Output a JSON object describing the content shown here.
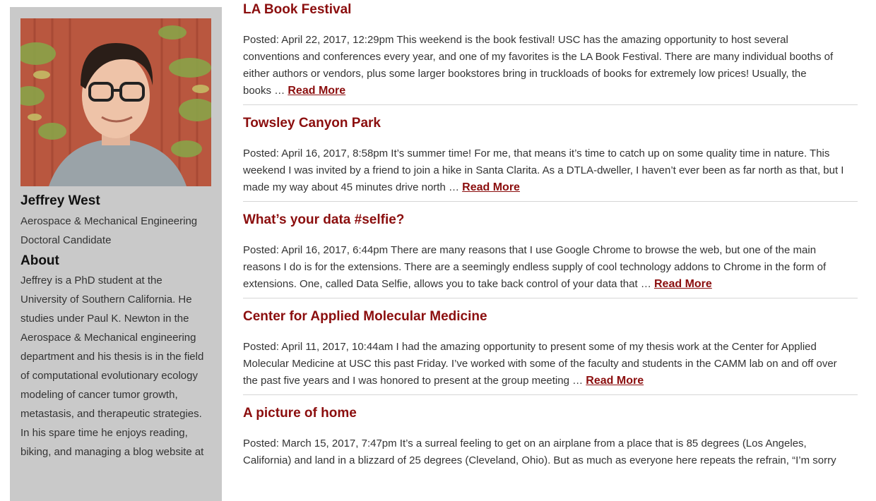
{
  "profile": {
    "name": "Jeffrey West",
    "role_line1": "Aerospace & Mechanical Engineering",
    "role_line2": "Doctoral Candidate",
    "about_heading": "About",
    "about_lines": [
      "Jeffrey is a PhD student at the",
      "University of Southern California. He",
      "studies under Paul K. Newton in the",
      "Aerospace & Mechanical engineering",
      "department and his thesis is in the field",
      "of computational evolutionary ecology",
      "modeling of cancer tumor growth,",
      "metastasis, and therapeutic strategies.",
      "In his spare time he enjoys reading,",
      "biking, and managing a blog website at"
    ]
  },
  "posts": [
    {
      "title": "LA Book Festival",
      "lines": [
        "Posted: April 22, 2017, 12:29pm This weekend is the book festival! USC has the amazing opportunity to host several",
        "conventions and conferences every year, and one of my favorites is the LA Book Festival. There are  many individual booths of",
        "either authors or vendors, plus some larger bookstores bring in truckloads of books for extremely low prices! Usually, the"
      ],
      "last_line": "books …",
      "read_more": "Read More"
    },
    {
      "title": "Towsley Canyon Park",
      "lines": [
        "Posted: April 16, 2017, 8:58pm It’s summer time! For me, that means it’s time to catch up on some quality time in nature. This",
        "weekend I was invited by a friend to join a hike in Santa Clarita. As a DTLA-dweller, I haven’t ever been as far north as that, but I"
      ],
      "last_line": "made my way about 45 minutes drive north …",
      "read_more": "Read More"
    },
    {
      "title": "What’s your data #selfie?",
      "lines": [
        "Posted: April 16, 2017, 6:44pm There are many reasons that I use Google Chrome to browse the web, but one of the main",
        "reasons I do is for the extensions. There are a seemingly endless supply of cool technology addons to Chrome in the form of"
      ],
      "last_line": "extensions. One, called Data Selfie, allows you to take back control of your data that …",
      "read_more": "Read More"
    },
    {
      "title": "Center for Applied Molecular Medicine",
      "lines": [
        "Posted: April 11, 2017, 10:44am I had the amazing opportunity to present some of my thesis work at the Center for Applied",
        "Molecular Medicine at USC this past Friday. I’ve worked with some of the faculty and students in the CAMM lab on and off over"
      ],
      "last_line": "the past five years and I was honored to present at the group meeting …",
      "read_more": "Read More"
    },
    {
      "title": "A picture of home",
      "lines": [
        "Posted: March 15, 2017, 7:47pm It’s a surreal feeling to get on an airplane from a place that is 85 degrees (Los Angeles,",
        "California) and land in a blizzard of 25 degrees (Cleveland, Ohio). But as much as everyone here repeats the refrain, “I’m sorry"
      ],
      "last_line": "",
      "read_more": ""
    }
  ],
  "colors": {
    "accent": "#8b0e0e",
    "sidebar_bg": "#c9c9c9",
    "divider": "#d6d6d6"
  }
}
